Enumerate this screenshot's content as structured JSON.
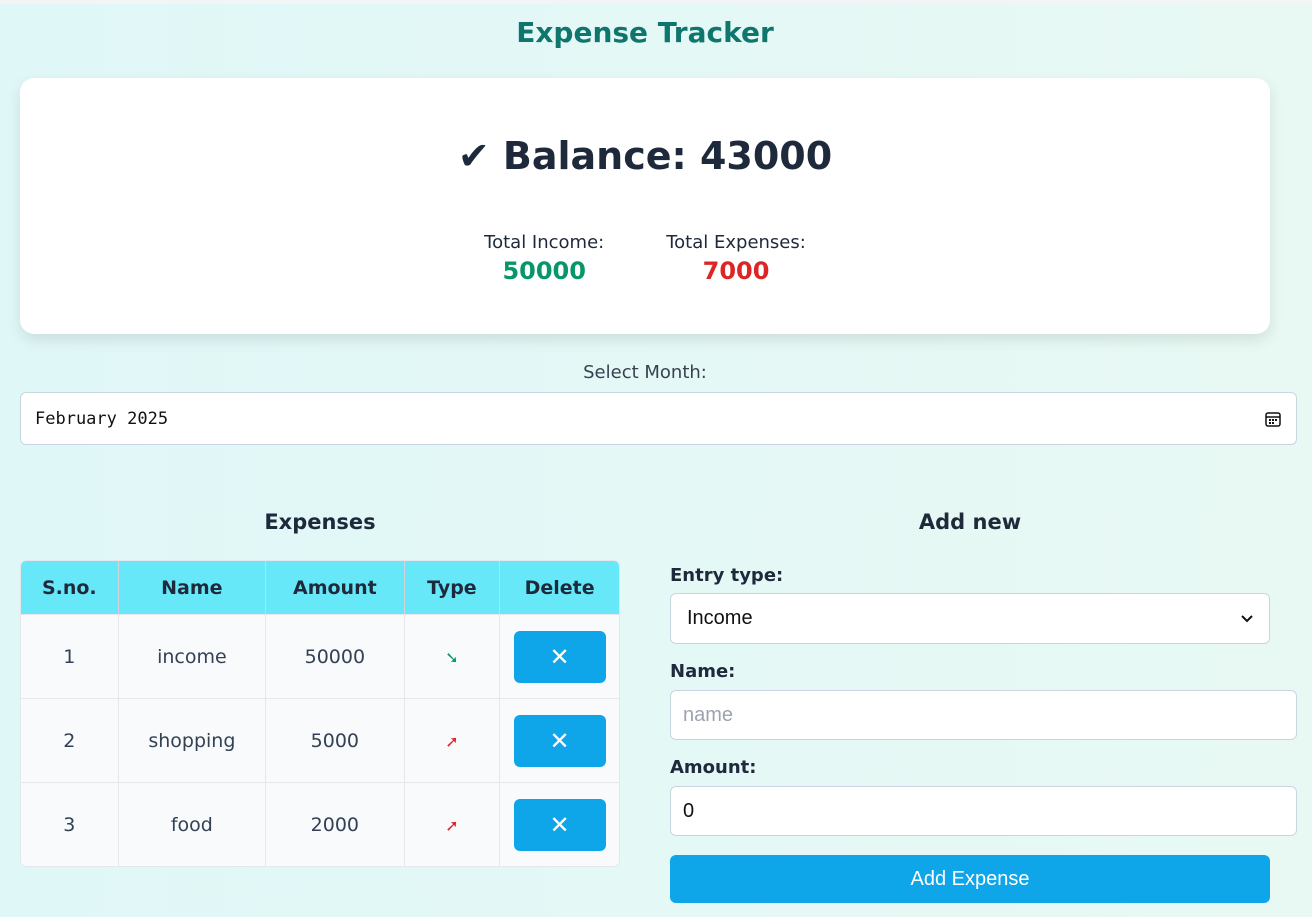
{
  "app": {
    "title": "Expense Tracker"
  },
  "summary": {
    "balance_check": "✔",
    "balance_label": "Balance: 43000",
    "income_label": "Total Income:",
    "income_value": "50000",
    "expenses_label": "Total Expenses:",
    "expenses_value": "7000"
  },
  "month": {
    "label": "Select Month:",
    "value": "February 2025"
  },
  "expenses_table": {
    "heading": "Expenses",
    "columns": [
      "S.no.",
      "Name",
      "Amount",
      "Type",
      "Delete"
    ],
    "rows": [
      {
        "sno": "1",
        "name": "income",
        "amount": "50000",
        "type_arrow": "➘",
        "delete": "✕"
      },
      {
        "sno": "2",
        "name": "shopping",
        "amount": "5000",
        "type_arrow": "➚",
        "delete": "✕"
      },
      {
        "sno": "3",
        "name": "food",
        "amount": "2000",
        "type_arrow": "➚",
        "delete": "✕"
      }
    ]
  },
  "form": {
    "heading": "Add new",
    "entry_type_label": "Entry type:",
    "entry_type_value": "Income",
    "name_label": "Name:",
    "name_placeholder": "name",
    "amount_label": "Amount:",
    "amount_value": "0",
    "submit_label": "Add Expense"
  },
  "colors": {
    "income": "#059669",
    "expense": "#dc2626",
    "accent": "#0ea5e9",
    "header": "#67e8f9",
    "title": "#0f766e"
  }
}
